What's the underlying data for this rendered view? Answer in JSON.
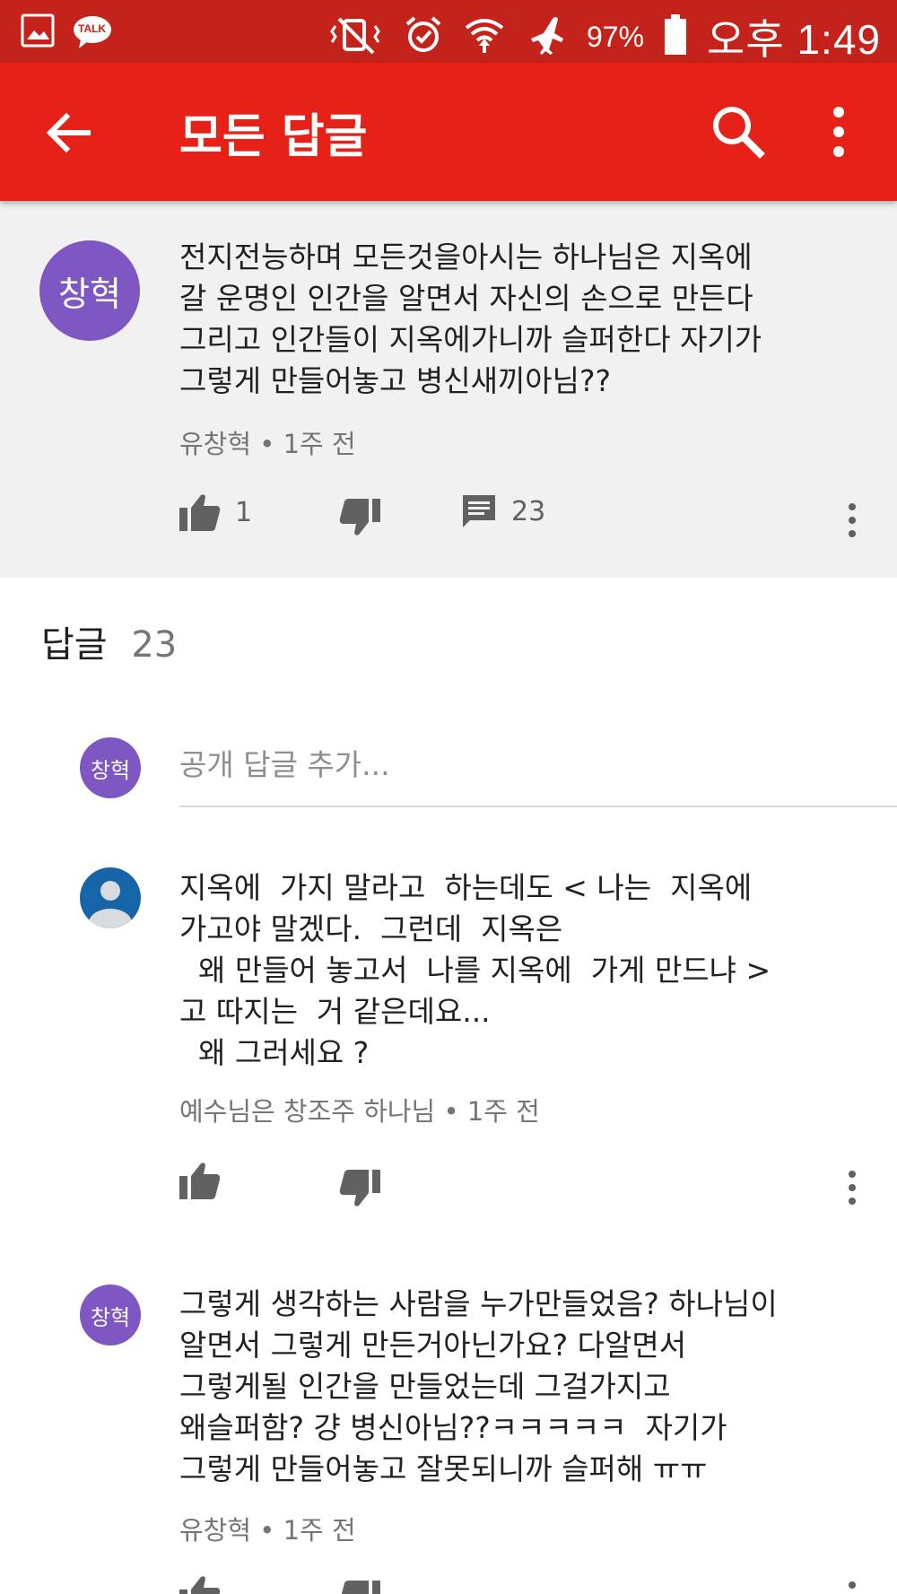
{
  "status_bar": {
    "battery_percent": "97%",
    "time": "오후 1:49",
    "left_icons": [
      "gallery-icon",
      "kakaotalk-icon"
    ],
    "kakao_label": "TALK",
    "right_icons": [
      "vibrate-off-icon",
      "alarm-icon",
      "wifi-icon",
      "airplane-icon",
      "battery-icon"
    ]
  },
  "app_bar": {
    "title": "모든 답글"
  },
  "parent_comment": {
    "avatar_text": "창혁",
    "text": "전지전능하며 모든것을아시는 하나님은 지옥에\n갈 운명인 인간을 알면서 자신의 손으로 만든다\n그리고 인간들이 지옥에가니까 슬퍼한다 자기가\n그렇게 만들어놓고 병신새끼아님??",
    "author": "유창혁",
    "time": "1주 전",
    "likes": "1",
    "replies": "23"
  },
  "replies_header": {
    "label": "답글",
    "count": "23"
  },
  "reply_input": {
    "avatar_text": "창혁",
    "placeholder": "공개 답글 추가..."
  },
  "replies": [
    {
      "text": "지옥에  가지 말라고  하는데도 < 나는  지옥에\n가고야 말겠다.  그런데  지옥은\n  왜 만들어 놓고서  나를 지옥에  가게 만드냐 >\n고 따지는  거 같은데요...\n  왜 그러세요 ?",
      "author": "예수님은 창조주 하나님",
      "time": "1주 전"
    },
    {
      "avatar_text": "창혁",
      "text": "그렇게 생각하는 사람을 누가만들었음? 하나님이\n알면서 그렇게 만든거아닌가요? 다알면서\n그렇게될 인간을 만들었는데 그걸가지고\n왜슬퍼함? 걍 병신아님??ㅋㅋㅋㅋㅋ  자기가\n그렇게 만들어놓고 잘못되니까 슬퍼해 ㅠㅠ",
      "author": "유창혁",
      "time": "1주 전"
    }
  ],
  "colors": {
    "status_bar": "#c4231b",
    "app_bar": "#e62117",
    "avatar_purple": "#7e57c2",
    "parent_bg": "#f1f1f1"
  }
}
